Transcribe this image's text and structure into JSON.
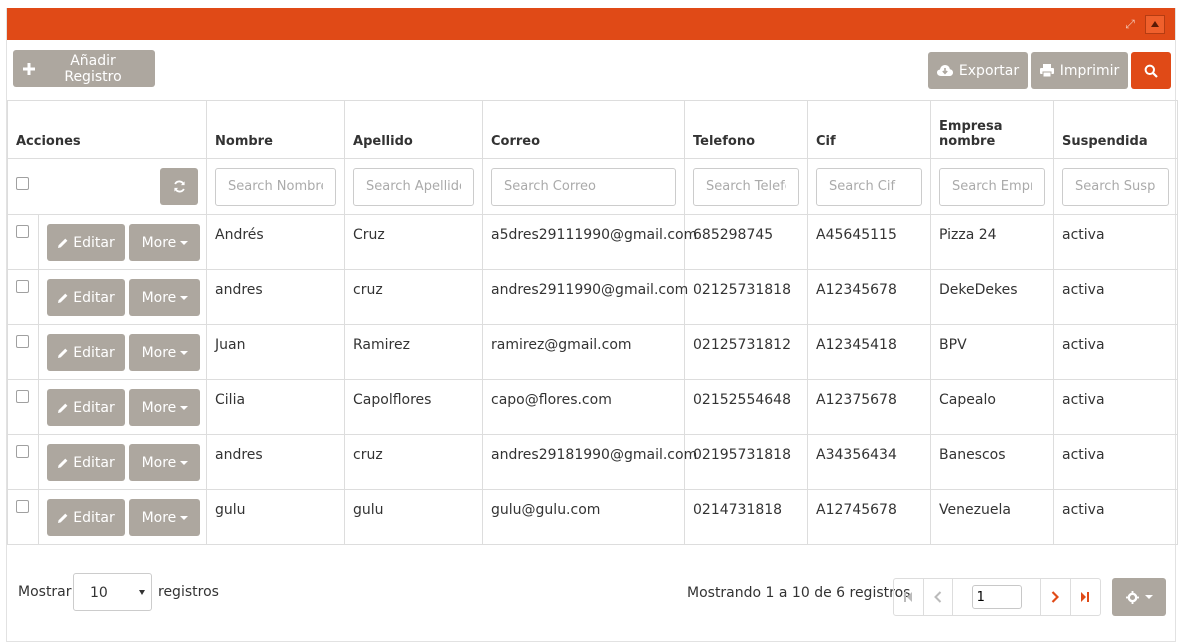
{
  "toolbar": {
    "add_label": "Añadir Registro",
    "export_label": "Exportar",
    "print_label": "Imprimir"
  },
  "columns": [
    "Acciones",
    "Nombre",
    "Apellido",
    "Correo",
    "Telefono",
    "Cif",
    "Empresa nombre",
    "Suspendida"
  ],
  "filters": {
    "nombre": "Search Nombre",
    "apellido": "Search Apellido",
    "correo": "Search Correo",
    "telefono": "Search Telefono",
    "cif": "Search Cif",
    "empresa": "Search Empresa nombre",
    "suspendida": "Search Suspendida"
  },
  "row_actions": {
    "edit_label": "Editar",
    "more_label": "More"
  },
  "rows": [
    {
      "nombre": "Andrés",
      "apellido": "Cruz",
      "correo": "a5dres29111990@gmail.com",
      "telefono": "685298745",
      "cif": "A45645115",
      "empresa": "Pizza 24",
      "suspendida": "activa"
    },
    {
      "nombre": "andres",
      "apellido": "cruz",
      "correo": "andres2911990@gmail.com",
      "telefono": "02125731818",
      "cif": "A12345678",
      "empresa": "DekeDekes",
      "suspendida": "activa"
    },
    {
      "nombre": "Juan",
      "apellido": "Ramirez",
      "correo": "ramirez@gmail.com",
      "telefono": "02125731812",
      "cif": "A12345418",
      "empresa": "BPV",
      "suspendida": "activa"
    },
    {
      "nombre": "Cilia",
      "apellido": "Capolflores",
      "correo": "capo@flores.com",
      "telefono": "02152554648",
      "cif": "A12375678",
      "empresa": "Capealo",
      "suspendida": "activa"
    },
    {
      "nombre": "andres",
      "apellido": "cruz",
      "correo": "andres29181990@gmail.com",
      "telefono": "02195731818",
      "cif": "A34356434",
      "empresa": "Banescos",
      "suspendida": "activa"
    },
    {
      "nombre": "gulu",
      "apellido": "gulu",
      "correo": "gulu@gulu.com",
      "telefono": "0214731818",
      "cif": "A12745678",
      "empresa": "Venezuela",
      "suspendida": "activa"
    }
  ],
  "footer": {
    "show_label": "Mostrar",
    "page_size": "10",
    "records_label": "registros",
    "summary": "Mostrando 1 a 10 de 6 registros",
    "current_page": "1"
  },
  "colors": {
    "accent": "#e04a17",
    "button_gray": "#ada79f"
  }
}
